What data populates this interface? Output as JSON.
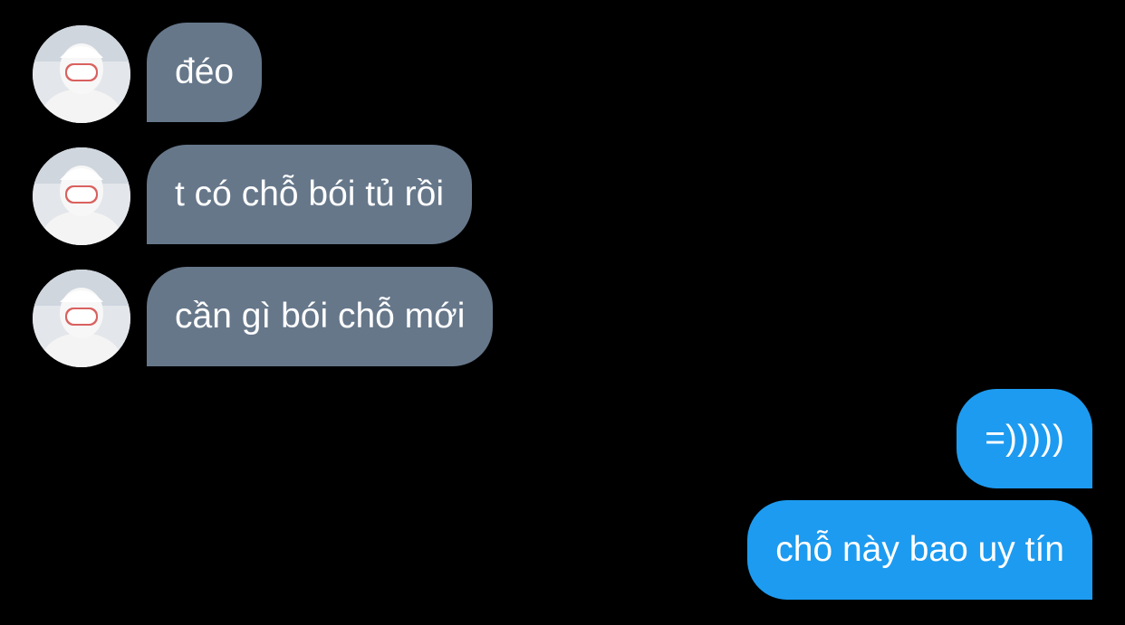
{
  "conversation": {
    "incoming": [
      {
        "text": "đéo"
      },
      {
        "text": "t có chỗ bói tủ rồi"
      },
      {
        "text": "cần gì bói chỗ mới"
      }
    ],
    "outgoing": [
      {
        "text": "=)))))"
      },
      {
        "text": "chỗ này bao uy tín"
      }
    ]
  },
  "colors": {
    "background": "#000000",
    "incoming_bubble": "#66778a",
    "outgoing_bubble": "#1d9bf0",
    "text": "#ffffff"
  },
  "icons": {
    "avatar": "avatar-icon"
  }
}
